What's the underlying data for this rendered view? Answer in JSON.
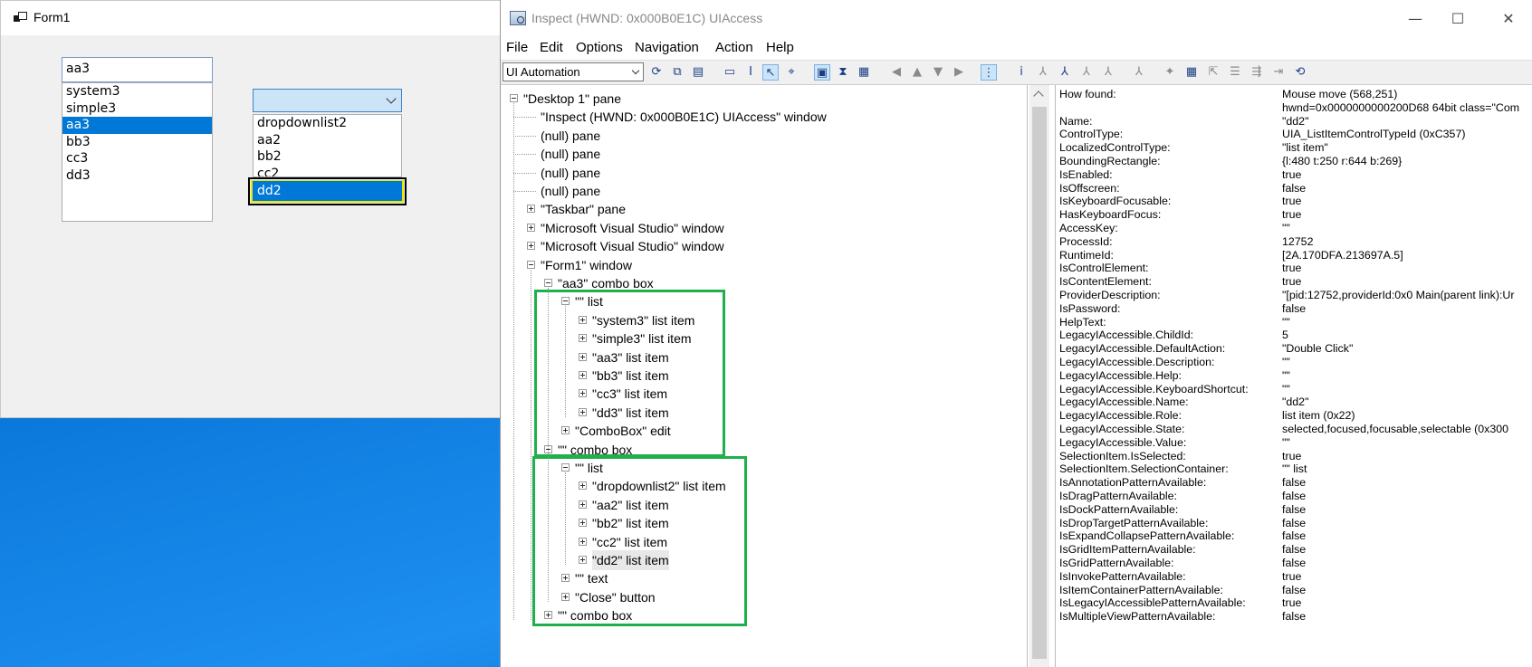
{
  "form1": {
    "title": "Form1",
    "textbox_value": "aa3",
    "list_items": [
      {
        "label": "system3",
        "selected": false
      },
      {
        "label": "simple3",
        "selected": false
      },
      {
        "label": "aa3",
        "selected": true
      },
      {
        "label": "bb3",
        "selected": false
      },
      {
        "label": "cc3",
        "selected": false
      },
      {
        "label": "dd3",
        "selected": false
      }
    ],
    "combo_value": "",
    "dropdown_items": [
      "dropdownlist2",
      "aa2",
      "bb2",
      "cc2"
    ],
    "highlighted_item": "dd2"
  },
  "inspect": {
    "title": "Inspect  (HWND: 0x000B0E1C) UIAccess",
    "window_controls": {
      "minimize": "—",
      "maximize": "☐",
      "close": "✕"
    },
    "menu": [
      "File",
      "Edit",
      "Options",
      "Navigation",
      "Action",
      "Help"
    ],
    "mode": "UI Automation",
    "tree": [
      {
        "label": "\"Desktop 1\" pane",
        "depth": 0,
        "exp": "minus"
      },
      {
        "label": "\"Inspect  (HWND: 0x000B0E1C) UIAccess\" window",
        "depth": 1,
        "exp": "none"
      },
      {
        "label": "(null) pane",
        "depth": 1,
        "exp": "none"
      },
      {
        "label": "(null) pane",
        "depth": 1,
        "exp": "none"
      },
      {
        "label": "(null) pane",
        "depth": 1,
        "exp": "none"
      },
      {
        "label": "(null) pane",
        "depth": 1,
        "exp": "none"
      },
      {
        "label": "\"Taskbar\" pane",
        "depth": 1,
        "exp": "plus"
      },
      {
        "label": "\"Microsoft Visual Studio\" window",
        "depth": 1,
        "exp": "plus"
      },
      {
        "label": "\"Microsoft Visual Studio\" window",
        "depth": 1,
        "exp": "plus"
      },
      {
        "label": "\"Form1\" window",
        "depth": 1,
        "exp": "minus"
      },
      {
        "label": "\"aa3\" combo box",
        "depth": 2,
        "exp": "minus"
      },
      {
        "label": "\"\" list",
        "depth": 3,
        "exp": "minus"
      },
      {
        "label": "\"system3\" list item",
        "depth": 4,
        "exp": "plus"
      },
      {
        "label": "\"simple3\" list item",
        "depth": 4,
        "exp": "plus"
      },
      {
        "label": "\"aa3\" list item",
        "depth": 4,
        "exp": "plus"
      },
      {
        "label": "\"bb3\" list item",
        "depth": 4,
        "exp": "plus"
      },
      {
        "label": "\"cc3\" list item",
        "depth": 4,
        "exp": "plus"
      },
      {
        "label": "\"dd3\" list item",
        "depth": 4,
        "exp": "plus"
      },
      {
        "label": "\"ComboBox\" edit",
        "depth": 3,
        "exp": "plus"
      },
      {
        "label": "\"\" combo box",
        "depth": 2,
        "exp": "minus"
      },
      {
        "label": "\"\" list",
        "depth": 3,
        "exp": "minus"
      },
      {
        "label": "\"dropdownlist2\" list item",
        "depth": 4,
        "exp": "plus"
      },
      {
        "label": "\"aa2\" list item",
        "depth": 4,
        "exp": "plus"
      },
      {
        "label": "\"bb2\" list item",
        "depth": 4,
        "exp": "plus"
      },
      {
        "label": "\"cc2\" list item",
        "depth": 4,
        "exp": "plus"
      },
      {
        "label": "\"dd2\" list item",
        "depth": 4,
        "exp": "plus",
        "selected": true
      },
      {
        "label": "\"\" text",
        "depth": 3,
        "exp": "plus"
      },
      {
        "label": "\"Close\" button",
        "depth": 3,
        "exp": "plus"
      },
      {
        "label": "\"\" combo box",
        "depth": 2,
        "exp": "plus"
      }
    ],
    "properties": [
      {
        "name": "How found:",
        "value": "Mouse move (568,251)"
      },
      {
        "name": "",
        "value": "hwnd=0x0000000000200D68 64bit class=\"Com"
      },
      {
        "name": "Name:",
        "value": "\"dd2\""
      },
      {
        "name": "ControlType:",
        "value": "UIA_ListItemControlTypeId (0xC357)"
      },
      {
        "name": "LocalizedControlType:",
        "value": "\"list item\""
      },
      {
        "name": "BoundingRectangle:",
        "value": "{l:480 t:250 r:644 b:269}"
      },
      {
        "name": "IsEnabled:",
        "value": "true"
      },
      {
        "name": "IsOffscreen:",
        "value": "false"
      },
      {
        "name": "IsKeyboardFocusable:",
        "value": "true"
      },
      {
        "name": "HasKeyboardFocus:",
        "value": "true"
      },
      {
        "name": "AccessKey:",
        "value": "\"\""
      },
      {
        "name": "ProcessId:",
        "value": "12752"
      },
      {
        "name": "RuntimeId:",
        "value": "[2A.170DFA.213697A.5]"
      },
      {
        "name": "IsControlElement:",
        "value": "true"
      },
      {
        "name": "IsContentElement:",
        "value": "true"
      },
      {
        "name": "ProviderDescription:",
        "value": "\"[pid:12752,providerId:0x0 Main(parent link):Ur"
      },
      {
        "name": "IsPassword:",
        "value": "false"
      },
      {
        "name": "HelpText:",
        "value": "\"\""
      },
      {
        "name": "LegacyIAccessible.ChildId:",
        "value": "5"
      },
      {
        "name": "LegacyIAccessible.DefaultAction:",
        "value": "\"Double Click\""
      },
      {
        "name": "LegacyIAccessible.Description:",
        "value": "\"\""
      },
      {
        "name": "LegacyIAccessible.Help:",
        "value": "\"\""
      },
      {
        "name": "LegacyIAccessible.KeyboardShortcut:",
        "value": "\"\""
      },
      {
        "name": "LegacyIAccessible.Name:",
        "value": "\"dd2\""
      },
      {
        "name": "LegacyIAccessible.Role:",
        "value": "list item (0x22)"
      },
      {
        "name": "LegacyIAccessible.State:",
        "value": "selected,focused,focusable,selectable (0x300"
      },
      {
        "name": "LegacyIAccessible.Value:",
        "value": "\"\""
      },
      {
        "name": "SelectionItem.IsSelected:",
        "value": "true"
      },
      {
        "name": "SelectionItem.SelectionContainer:",
        "value": "\"\" list"
      },
      {
        "name": "IsAnnotationPatternAvailable:",
        "value": "false"
      },
      {
        "name": "IsDragPatternAvailable:",
        "value": "false"
      },
      {
        "name": "IsDockPatternAvailable:",
        "value": "false"
      },
      {
        "name": "IsDropTargetPatternAvailable:",
        "value": "false"
      },
      {
        "name": "IsExpandCollapsePatternAvailable:",
        "value": "false"
      },
      {
        "name": "IsGridItemPatternAvailable:",
        "value": "false"
      },
      {
        "name": "IsGridPatternAvailable:",
        "value": "false"
      },
      {
        "name": "IsInvokePatternAvailable:",
        "value": "true"
      },
      {
        "name": "IsItemContainerPatternAvailable:",
        "value": "false"
      },
      {
        "name": "IsLegacyIAccessiblePatternAvailable:",
        "value": "true"
      },
      {
        "name": "IsMultipleViewPatternAvailable:",
        "value": "false"
      }
    ]
  },
  "colors": {
    "selection": "#0078d7",
    "highlight_box": "#1fb04b",
    "desktop": "#0b79db"
  }
}
